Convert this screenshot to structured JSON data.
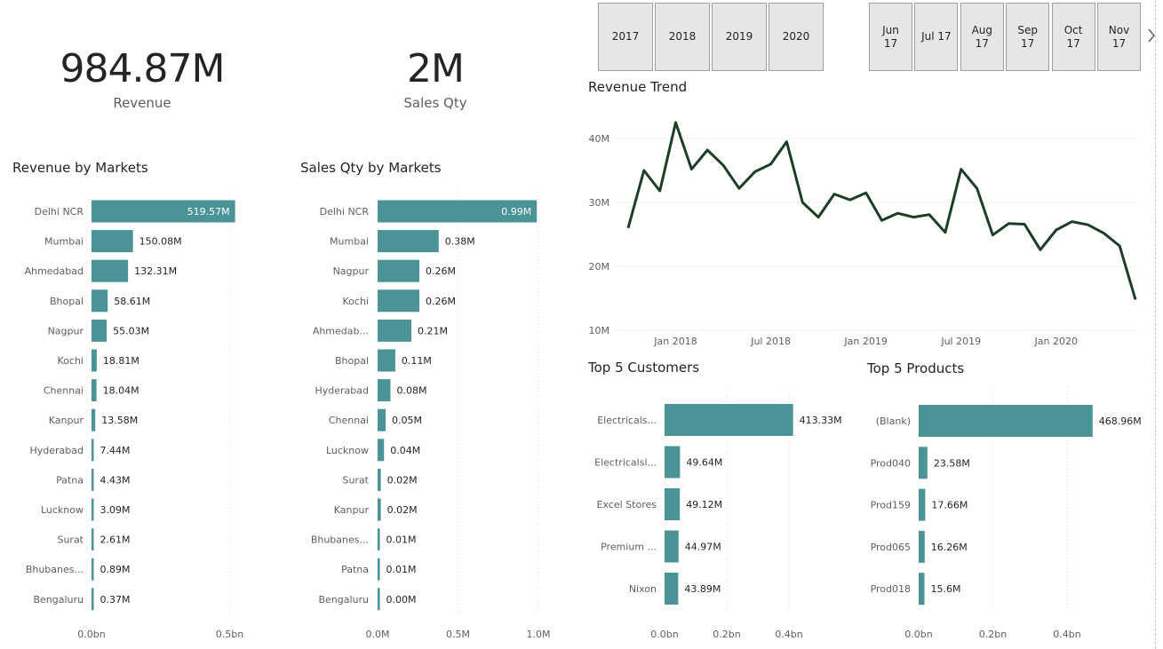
{
  "kpis": {
    "revenue": {
      "value": "984.87M",
      "label": "Revenue"
    },
    "sales_qty": {
      "value": "2M",
      "label": "Sales Qty"
    }
  },
  "year_slicer": [
    "2017",
    "2018",
    "2019",
    "2020"
  ],
  "month_slicer": [
    "Jun 17",
    "Jul 17",
    "Aug 17",
    "Sep 17",
    "Oct 17",
    "Nov 17"
  ],
  "colors": {
    "bar": "#4a9397",
    "line": "#1e3d26",
    "grid": "#d6d6d6"
  },
  "chart_data": [
    {
      "id": "revenue_by_markets",
      "type": "bar",
      "orientation": "horizontal",
      "title": "Revenue by Markets",
      "categories": [
        "Delhi NCR",
        "Mumbai",
        "Ahmedabad",
        "Bhopal",
        "Nagpur",
        "Kochi",
        "Chennai",
        "Kanpur",
        "Hyderabad",
        "Patna",
        "Lucknow",
        "Surat",
        "Bhubanes...",
        "Bengaluru"
      ],
      "values": [
        519.57,
        150.08,
        132.31,
        58.61,
        55.03,
        18.81,
        18.04,
        13.58,
        7.44,
        4.43,
        3.09,
        2.61,
        0.89,
        0.37
      ],
      "data_labels": [
        "519.57M",
        "150.08M",
        "132.31M",
        "58.61M",
        "55.03M",
        "18.81M",
        "18.04M",
        "13.58M",
        "7.44M",
        "4.43M",
        "3.09M",
        "2.61M",
        "0.89M",
        "0.37M"
      ],
      "unit": "M",
      "xlim": [
        0,
        580
      ],
      "x_ticks": [
        {
          "v": 0,
          "label": "0.0bn"
        },
        {
          "v": 500,
          "label": "0.5bn"
        }
      ]
    },
    {
      "id": "sales_qty_by_markets",
      "type": "bar",
      "orientation": "horizontal",
      "title": "Sales Qty by Markets",
      "categories": [
        "Delhi NCR",
        "Mumbai",
        "Nagpur",
        "Kochi",
        "Ahmedab...",
        "Bhopal",
        "Hyderabad",
        "Chennai",
        "Lucknow",
        "Surat",
        "Kanpur",
        "Bhubanes...",
        "Patna",
        "Bengaluru"
      ],
      "values": [
        0.99,
        0.38,
        0.26,
        0.26,
        0.21,
        0.11,
        0.08,
        0.05,
        0.04,
        0.02,
        0.02,
        0.01,
        0.01,
        0.0
      ],
      "data_labels": [
        "0.99M",
        "0.38M",
        "0.26M",
        "0.26M",
        "0.21M",
        "0.11M",
        "0.08M",
        "0.05M",
        "0.04M",
        "0.02M",
        "0.02M",
        "0.01M",
        "0.01M",
        "0.00M"
      ],
      "unit": "M",
      "xlim": [
        0,
        1.0
      ],
      "x_ticks": [
        {
          "v": 0,
          "label": "0.0M"
        },
        {
          "v": 0.5,
          "label": "0.5M"
        },
        {
          "v": 1.0,
          "label": "1.0M"
        }
      ]
    },
    {
      "id": "revenue_trend",
      "type": "line",
      "title": "Revenue Trend",
      "x": [
        "2017-10",
        "2017-11",
        "2017-12",
        "2018-01",
        "2018-02",
        "2018-03",
        "2018-04",
        "2018-05",
        "2018-06",
        "2018-07",
        "2018-08",
        "2018-09",
        "2018-10",
        "2018-11",
        "2018-12",
        "2019-01",
        "2019-02",
        "2019-03",
        "2019-04",
        "2019-05",
        "2019-06",
        "2019-07",
        "2019-08",
        "2019-09",
        "2019-10",
        "2019-11",
        "2019-12",
        "2020-01",
        "2020-02",
        "2020-03",
        "2020-04",
        "2020-05",
        "2020-06"
      ],
      "values": [
        26.0,
        35.0,
        31.8,
        42.5,
        35.2,
        38.2,
        35.8,
        32.2,
        34.8,
        36.0,
        39.5,
        30.0,
        27.7,
        31.3,
        30.4,
        31.5,
        27.2,
        28.3,
        27.7,
        28.1,
        25.3,
        35.2,
        32.2,
        24.9,
        26.7,
        26.6,
        22.6,
        25.7,
        27.0,
        26.5,
        25.2,
        23.2,
        14.8
      ],
      "unit": "M",
      "ylim": [
        10,
        45
      ],
      "y_ticks": [
        {
          "v": 10,
          "label": "10M"
        },
        {
          "v": 20,
          "label": "20M"
        },
        {
          "v": 30,
          "label": "30M"
        },
        {
          "v": 40,
          "label": "40M"
        }
      ],
      "x_ticks": [
        {
          "v": "2018-01",
          "label": "Jan 2018"
        },
        {
          "v": "2018-07",
          "label": "Jul 2018"
        },
        {
          "v": "2019-01",
          "label": "Jan 2019"
        },
        {
          "v": "2019-07",
          "label": "Jul 2019"
        },
        {
          "v": "2020-01",
          "label": "Jan 2020"
        }
      ],
      "grid": true
    },
    {
      "id": "top5_customers",
      "type": "bar",
      "orientation": "horizontal",
      "title": "Top 5 Customers",
      "categories": [
        "Electricals...",
        "Electricalsl...",
        "Excel Stores",
        "Premium ...",
        "Nixon"
      ],
      "values": [
        413.33,
        49.64,
        49.12,
        44.97,
        43.89
      ],
      "data_labels": [
        "413.33M",
        "49.64M",
        "49.12M",
        "44.97M",
        "43.89M"
      ],
      "unit": "M",
      "xlim": [
        0,
        480
      ],
      "x_ticks": [
        {
          "v": 0,
          "label": "0.0bn"
        },
        {
          "v": 200,
          "label": "0.2bn"
        },
        {
          "v": 400,
          "label": "0.4bn"
        }
      ]
    },
    {
      "id": "top5_products",
      "type": "bar",
      "orientation": "horizontal",
      "title": "Top 5 Products",
      "categories": [
        "(Blank)",
        "Prod040",
        "Prod159",
        "Prod065",
        "Prod018"
      ],
      "values": [
        468.96,
        23.58,
        17.66,
        16.26,
        15.6
      ],
      "data_labels": [
        "468.96M",
        "23.58M",
        "17.66M",
        "16.26M",
        "15.6M"
      ],
      "unit": "M",
      "xlim": [
        0,
        480
      ],
      "x_ticks": [
        {
          "v": 0,
          "label": "0.0bn"
        },
        {
          "v": 200,
          "label": "0.2bn"
        },
        {
          "v": 400,
          "label": "0.4bn"
        }
      ]
    }
  ]
}
